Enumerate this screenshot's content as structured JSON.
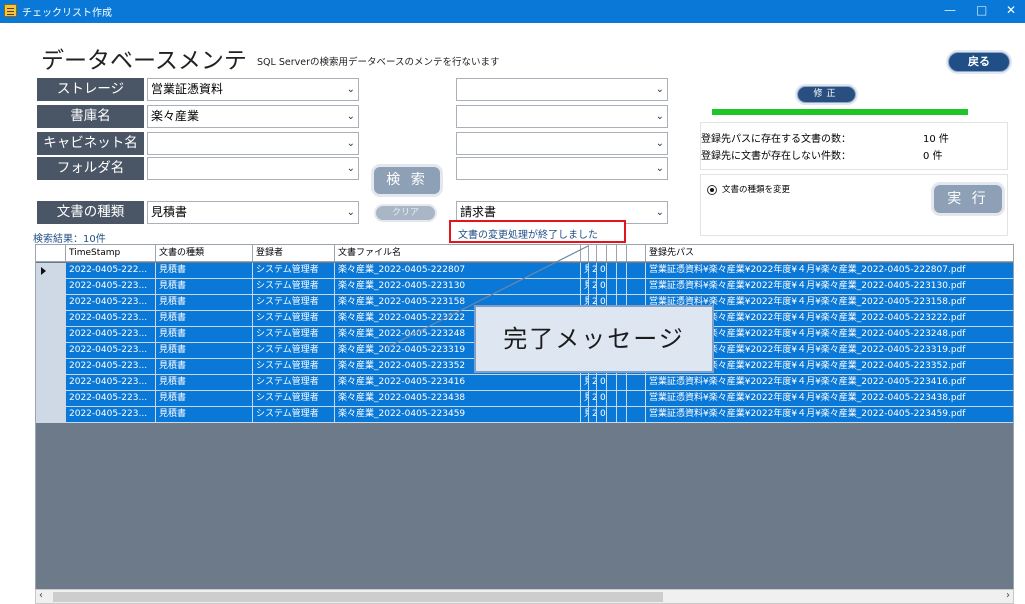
{
  "window": {
    "title": "チェックリスト作成",
    "controls": {
      "minimize": "—",
      "maximize": "□",
      "close": "✕"
    }
  },
  "header": {
    "title": "データベースメンテ",
    "subtitle": "SQL Serverの検索用データベースのメンテを行ないます",
    "back_label": "戻る"
  },
  "filters": {
    "labels": {
      "storage": "ストレージ",
      "library": "書庫名",
      "cabinet": "キャビネット名",
      "folder": "フォルダ名",
      "doc_type": "文書の種類"
    },
    "left": {
      "storage": "営業証憑資料",
      "library": "楽々産業",
      "cabinet": "",
      "folder": "",
      "doc_type": "見積書"
    },
    "right": {
      "storage": "",
      "library": "",
      "cabinet": "",
      "folder": "",
      "doc_type": "請求書"
    },
    "arrow": "⌄"
  },
  "actions": {
    "search_label": "検 索",
    "clear_label": "クリア",
    "fix_label": "修正",
    "execute_label": "実 行"
  },
  "info": {
    "progress": 1.0,
    "exist_label": "登録先パスに存在する文書の数：",
    "exist_count": "10 件",
    "missing_label": "登録先に文書が存在しない件数：",
    "missing_count": "0 件"
  },
  "option": {
    "radio_label": "文書の種類を変更",
    "checked": true
  },
  "status": {
    "result_count": "検索結果：10件",
    "done_message": "文書の変更処理が終了しました"
  },
  "grid": {
    "columns": [
      "TimeStamp",
      "文書の種類",
      "登録者",
      "文書ファイル名",
      "",
      "",
      "",
      "",
      "",
      "登録先パス"
    ],
    "rows": [
      [
        "2022-0405-222...",
        "見積書",
        "システム管理者",
        "楽々産業_2022-0405-222807",
        "見",
        "2",
        "0",
        "営業証憑資料¥楽々産業¥2022年度¥４月¥楽々産業_2022-0405-222807.pdf"
      ],
      [
        "2022-0405-223...",
        "見積書",
        "システム管理者",
        "楽々産業_2022-0405-223130",
        "見",
        "2",
        "0",
        "営業証憑資料¥楽々産業¥2022年度¥４月¥楽々産業_2022-0405-223130.pdf"
      ],
      [
        "2022-0405-223...",
        "見積書",
        "システム管理者",
        "楽々産業_2022-0405-223158",
        "見",
        "2",
        "0",
        "営業証憑資料¥楽々産業¥2022年度¥４月¥楽々産業_2022-0405-223158.pdf"
      ],
      [
        "2022-0405-223...",
        "見積書",
        "システム管理者",
        "楽々産業_2022-0405-223222",
        "見",
        "2",
        "0",
        "営業証憑資料¥楽々産業¥2022年度¥４月¥楽々産業_2022-0405-223222.pdf"
      ],
      [
        "2022-0405-223...",
        "見積書",
        "システム管理者",
        "楽々産業_2022-0405-223248",
        "見",
        "2",
        "0",
        "営業証憑資料¥楽々産業¥2022年度¥４月¥楽々産業_2022-0405-223248.pdf"
      ],
      [
        "2022-0405-223...",
        "見積書",
        "システム管理者",
        "楽々産業_2022-0405-223319",
        "見",
        "2",
        "0",
        "営業証憑資料¥楽々産業¥2022年度¥４月¥楽々産業_2022-0405-223319.pdf"
      ],
      [
        "2022-0405-223...",
        "見積書",
        "システム管理者",
        "楽々産業_2022-0405-223352",
        "見",
        "2",
        "0",
        "営業証憑資料¥楽々産業¥2022年度¥４月¥楽々産業_2022-0405-223352.pdf"
      ],
      [
        "2022-0405-223...",
        "見積書",
        "システム管理者",
        "楽々産業_2022-0405-223416",
        "見",
        "2",
        "0",
        "営業証憑資料¥楽々産業¥2022年度¥４月¥楽々産業_2022-0405-223416.pdf"
      ],
      [
        "2022-0405-223...",
        "見積書",
        "システム管理者",
        "楽々産業_2022-0405-223438",
        "見",
        "2",
        "0",
        "営業証憑資料¥楽々産業¥2022年度¥４月¥楽々産業_2022-0405-223438.pdf"
      ],
      [
        "2022-0405-223...",
        "見積書",
        "システム管理者",
        "楽々産業_2022-0405-223459",
        "見",
        "2",
        "0",
        "営業証憑資料¥楽々産業¥2022年度¥４月¥楽々産業_2022-0405-223459.pdf"
      ]
    ],
    "scroll_left": "‹",
    "scroll_right": "›"
  },
  "annotation": {
    "callout_text": "完了メッセージ"
  },
  "colors": {
    "titlebar": "#0a78d7",
    "row_selected": "#0a78d7",
    "label_bg": "#4a5565",
    "pill_btn": "#1f4f86",
    "progress": "#1ec524",
    "highlight_border": "#e3141b"
  }
}
